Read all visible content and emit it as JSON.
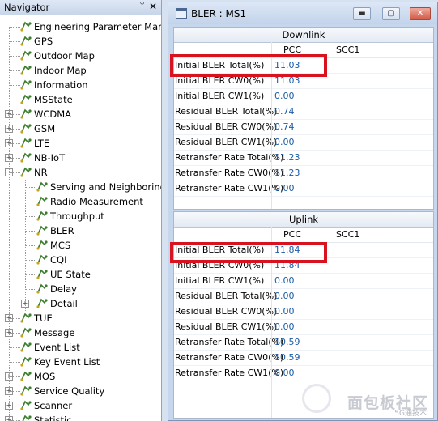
{
  "navigator": {
    "title": "Navigator",
    "pin_icon": "pin-icon",
    "close_icon": "close-icon",
    "items": [
      {
        "label": "Engineering Parameter Manag",
        "expandable": false
      },
      {
        "label": "GPS",
        "expandable": false
      },
      {
        "label": "Outdoor Map",
        "expandable": false
      },
      {
        "label": "Indoor Map",
        "expandable": false
      },
      {
        "label": "Information",
        "expandable": false
      },
      {
        "label": "MSState",
        "expandable": false
      },
      {
        "label": "WCDMA",
        "expandable": true,
        "expanded": false
      },
      {
        "label": "GSM",
        "expandable": true,
        "expanded": false
      },
      {
        "label": "LTE",
        "expandable": true,
        "expanded": false
      },
      {
        "label": "NB-IoT",
        "expandable": true,
        "expanded": false
      },
      {
        "label": "NR",
        "expandable": true,
        "expanded": true
      },
      {
        "label": "Serving and Neighboring",
        "child": true
      },
      {
        "label": "Radio Measurement",
        "child": true
      },
      {
        "label": "Throughput",
        "child": true
      },
      {
        "label": "BLER",
        "child": true
      },
      {
        "label": "MCS",
        "child": true
      },
      {
        "label": "CQI",
        "child": true
      },
      {
        "label": "UE State",
        "child": true
      },
      {
        "label": "Delay",
        "child": true
      },
      {
        "label": "Detail",
        "child": true,
        "expandable": true,
        "expanded": false
      },
      {
        "label": "TUE",
        "expandable": true,
        "expanded": false
      },
      {
        "label": "Message",
        "expandable": true,
        "expanded": false
      },
      {
        "label": "Event List",
        "expandable": false
      },
      {
        "label": "Key Event List",
        "expandable": false
      },
      {
        "label": "MOS",
        "expandable": true,
        "expanded": false
      },
      {
        "label": "Service Quality",
        "expandable": true,
        "expanded": false
      },
      {
        "label": "Scanner",
        "expandable": true,
        "expanded": false
      },
      {
        "label": "Statistic",
        "expandable": true,
        "expanded": false
      }
    ]
  },
  "window": {
    "title": "BLER : MS1",
    "buttons": {
      "minimize": "▬",
      "maximize": "▢",
      "close": "✕"
    },
    "downlink": {
      "section_title": "Downlink",
      "col1": "PCC",
      "col2": "SCC1",
      "rows": [
        {
          "name": "Initial BLER Total(%)",
          "value": "11.03"
        },
        {
          "name": "Initial BLER CW0(%)",
          "value": "11.03"
        },
        {
          "name": "Initial BLER CW1(%)",
          "value": "0.00"
        },
        {
          "name": "Residual BLER Total(%)",
          "value": "0.74"
        },
        {
          "name": "Residual BLER CW0(%)",
          "value": "0.74"
        },
        {
          "name": "Residual BLER CW1(%)",
          "value": "0.00"
        },
        {
          "name": "Retransfer Rate Total(%)",
          "value": "11.23"
        },
        {
          "name": "Retransfer Rate CW0(%)",
          "value": "11.23"
        },
        {
          "name": "Retransfer Rate CW1(%)",
          "value": "0.00"
        }
      ]
    },
    "uplink": {
      "section_title": "Uplink",
      "col1": "PCC",
      "col2": "SCC1",
      "rows": [
        {
          "name": "Initial BLER Total(%)",
          "value": "11.84"
        },
        {
          "name": "Initial BLER CW0(%)",
          "value": "11.84"
        },
        {
          "name": "Initial BLER CW1(%)",
          "value": "0.00"
        },
        {
          "name": "Residual BLER Total(%)",
          "value": "0.00"
        },
        {
          "name": "Residual BLER CW0(%)",
          "value": "0.00"
        },
        {
          "name": "Residual BLER CW1(%)",
          "value": "0.00"
        },
        {
          "name": "Retransfer Rate Total(%)",
          "value": "10.59"
        },
        {
          "name": "Retransfer Rate CW0(%)",
          "value": "10.59"
        },
        {
          "name": "Retransfer Rate CW1(%)",
          "value": "0.00"
        }
      ]
    }
  },
  "watermark": {
    "text": "面包板社区",
    "sub": "5G通技术"
  },
  "colors": {
    "highlight": "#d8121e",
    "value_text": "#1a5ba8",
    "accent": "#c6d6ec"
  }
}
